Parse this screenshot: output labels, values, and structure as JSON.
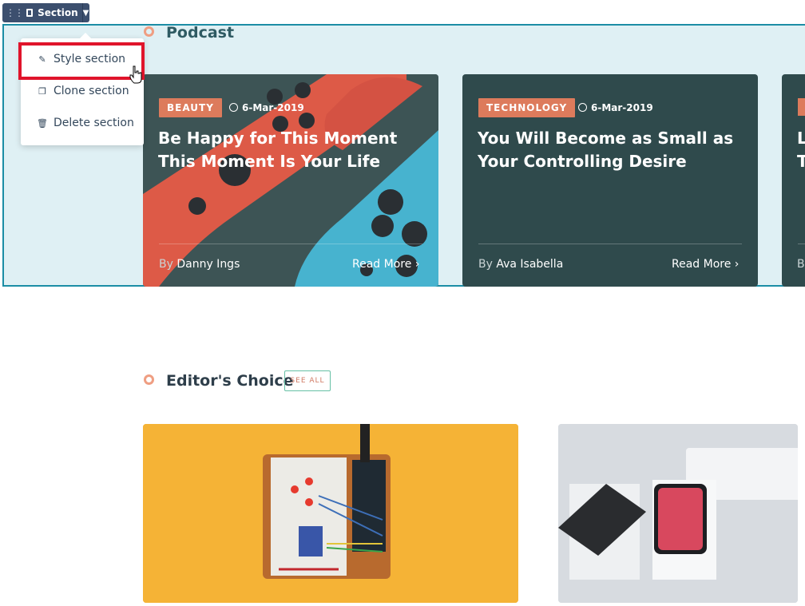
{
  "toolbar": {
    "drag_icon": "drag-handle-icon",
    "section_icon": "section-layout-icon",
    "label": "Section",
    "caret_icon": "caret-down-icon"
  },
  "menu": {
    "items": [
      {
        "label": "Style section",
        "icon": "pencil-icon"
      },
      {
        "label": "Clone section",
        "icon": "copy-icon"
      },
      {
        "label": "Delete section",
        "icon": "trash-icon"
      }
    ]
  },
  "podcast": {
    "title": "Podcast",
    "cards": [
      {
        "badge": "BEAUTY",
        "date": "6-Mar-2019",
        "title_line1": "Be Happy for This Moment",
        "title_line2": "This Moment Is Your Life",
        "author_prefix": "By",
        "author": "Danny Ings",
        "read_more": "Read More"
      },
      {
        "badge": "TECHNOLOGY",
        "date": "6-Mar-2019",
        "title_line1": "You Will Become as Small as",
        "title_line2": "Your Controlling Desire",
        "author_prefix": "By",
        "author": "Ava Isabella",
        "read_more": "Read More"
      }
    ],
    "partial_card": {
      "title_line1": "L",
      "title_line2": "T",
      "author_prefix": "B"
    }
  },
  "editors_choice": {
    "title": "Editor's Choice",
    "see_all": "SEE ALL"
  },
  "colors": {
    "section_bg": "#dff0f4",
    "section_border": "#1c8da5",
    "card_dark": "#2f4a4c",
    "badge": "#dd7b5c",
    "ring": "#ef9e82",
    "highlight": "#e0142b",
    "toolbar": "#3c4f6e"
  }
}
